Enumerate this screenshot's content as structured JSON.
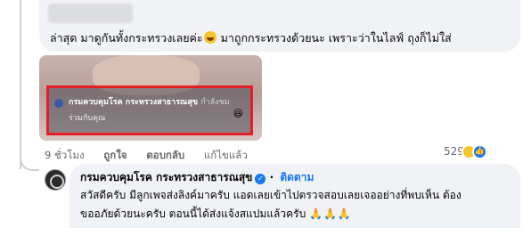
{
  "comment": {
    "text_before_emoji": "ล่าสุด มาดูกันทั้งกระทรวงเลยค่ะ",
    "text_after_emoji": " มาถูกกระทรวงด้วยนะ เพราะว่าในไลฟ์ ถุงก็ไม่ใส่",
    "emoji": "laughing-emoji"
  },
  "attachment": {
    "overlay_name": "กรมควบคุมโรค กระทรวงสาธารณสุข",
    "overlay_suffix": "กำลังชม",
    "overlay_sub": "ร่วมกับคุณ",
    "highlight_color": "#e41e24"
  },
  "actions": {
    "time": "9 ชั่วโมง",
    "like": "ถูกใจ",
    "reply": "ตอบกลับ",
    "edited": "แก้ไขแล้ว",
    "reaction_count": "529",
    "reaction_icons": [
      "haha-icon",
      "like-icon"
    ]
  },
  "reply": {
    "author": "กรมควบคุมโรค กระทรวงสาธารณสุข",
    "separator": "·",
    "follow": "ติดตาม",
    "line1": "สวัสดีครับ มีลูกเพจส่งลิงค์มาครับ แอดเลยเข้าไปตรวจสอบเลยเจออย่างที่พบเห็น ต้อง",
    "line2": "ขออภัยด้วยนะครับ ตอนนี้ได้ส่งแจ้งสแปมแล้วครับ",
    "pray_emojis": "🙏🙏🙏",
    "accent_color": "#1877f2"
  }
}
